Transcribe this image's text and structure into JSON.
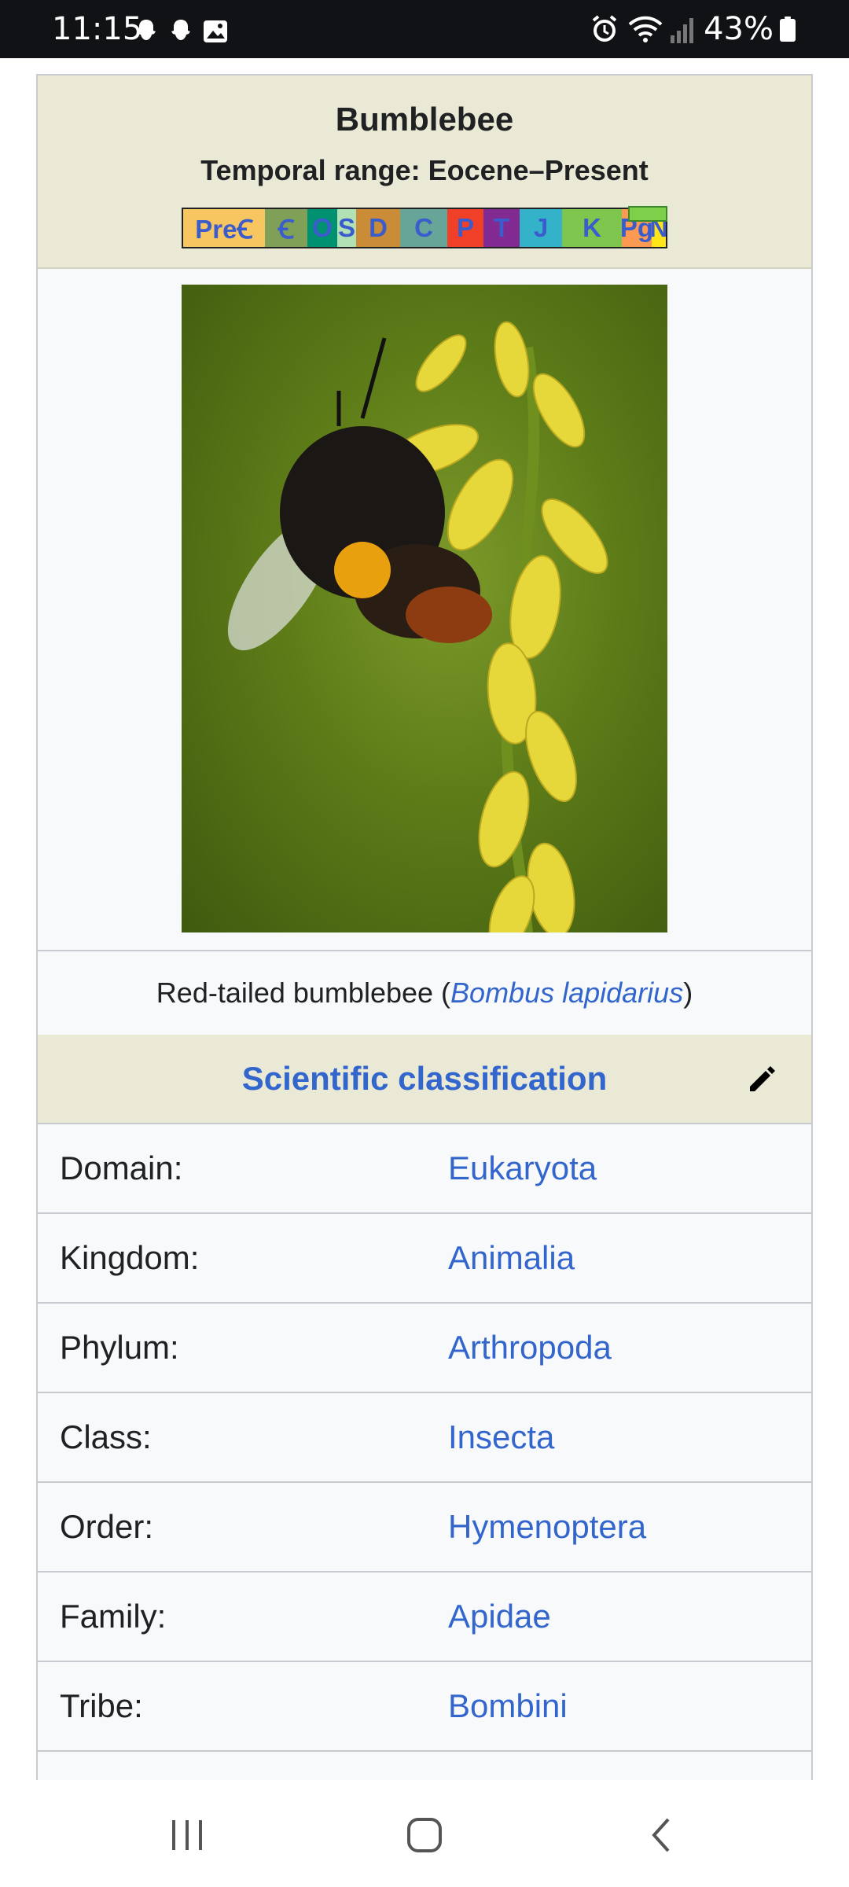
{
  "status_bar": {
    "time": "11:15",
    "left_icons": [
      "snapchat-icon",
      "snapchat-icon",
      "image-icon"
    ],
    "right_icons": [
      "alarm-icon",
      "wifi-6e-icon",
      "signal-icon"
    ],
    "battery_percent": "43%"
  },
  "infobox": {
    "title": "Bumblebee",
    "temporal_range": "Temporal range: Eocene–Present",
    "timeline_segments": [
      "PreꞒ",
      "Ꞓ",
      "O",
      "S",
      "D",
      "C",
      "P",
      "T",
      "J",
      "K",
      "Pg",
      "N"
    ],
    "image_alt": "bumblebee on yellow flowers",
    "caption_prefix": "Red-tailed bumblebee (",
    "caption_link": "Bombus lapidarius",
    "caption_suffix": ")",
    "classification_title": "Scientific classification",
    "rows": [
      {
        "label": "Domain:",
        "value": "Eukaryota"
      },
      {
        "label": "Kingdom:",
        "value": "Animalia"
      },
      {
        "label": "Phylum:",
        "value": "Arthropoda"
      },
      {
        "label": "Class:",
        "value": "Insecta"
      },
      {
        "label": "Order:",
        "value": "Hymenoptera"
      },
      {
        "label": "Family:",
        "value": "Apidae"
      },
      {
        "label": "Tribe:",
        "value": "Bombini"
      }
    ]
  },
  "colors": {
    "link": "#3366cc",
    "header_bg": "#e9e9d6",
    "infobox_bg": "#f8f9fa"
  }
}
